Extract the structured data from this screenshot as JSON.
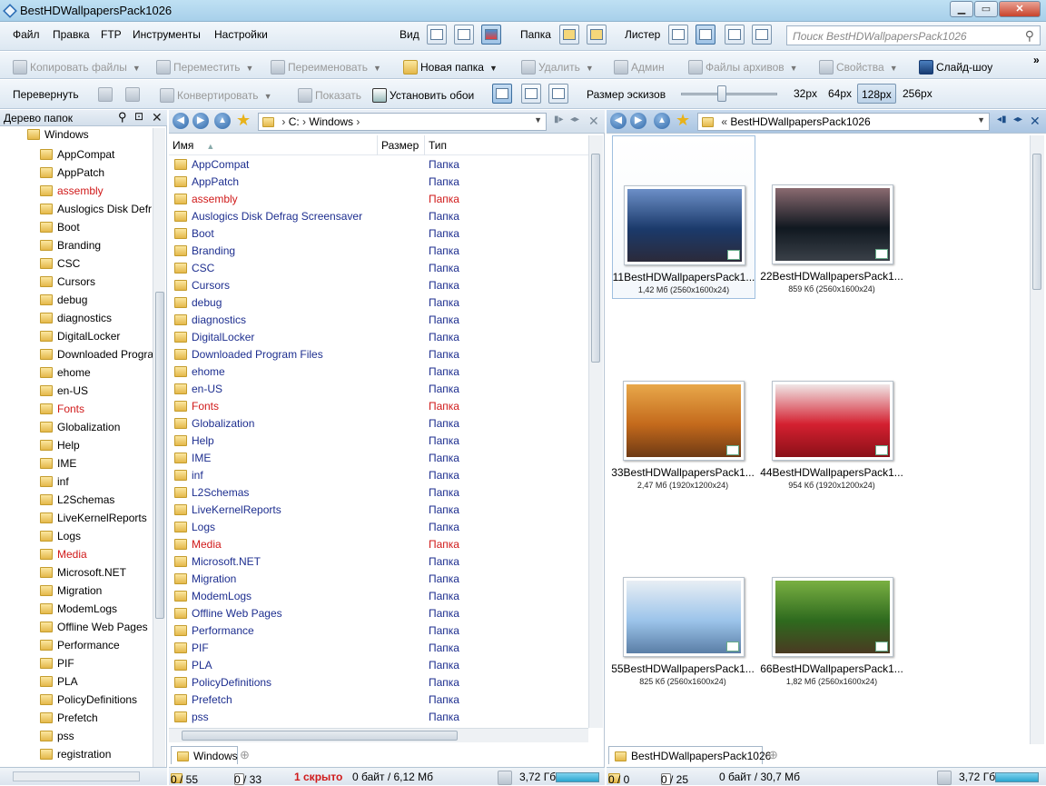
{
  "window": {
    "title": "BestHDWallpapersPack1026"
  },
  "menu": [
    "Файл",
    "Правка",
    "FTP",
    "Инструменты",
    "Настройки"
  ],
  "menu_right": {
    "view_label": "Вид",
    "folder_label": "Папка",
    "lister_label": "Листер"
  },
  "search": {
    "placeholder": "Поиск BestHDWallpapersPack1026"
  },
  "toolbar1": {
    "copy": "Копировать файлы",
    "move": "Переместить",
    "rename": "Переименовать",
    "new_folder": "Новая папка",
    "delete": "Удалить",
    "admin": "Админ",
    "archives": "Файлы архивов",
    "properties": "Свойства",
    "slideshow": "Слайд-шоу",
    "more": "»"
  },
  "toolbar2": {
    "flip": "Перевернуть",
    "convert": "Конвертировать",
    "show": "Показать",
    "set_wallpaper": "Установить обои",
    "thumb_size_label": "Размер эскизов",
    "sizes": [
      "32px",
      "64px",
      "128px",
      "256px"
    ],
    "selected_size": "128px"
  },
  "tree": {
    "header": "Дерево папок",
    "root": "Windows",
    "items": [
      {
        "name": "AppCompat",
        "red": false
      },
      {
        "name": "AppPatch",
        "red": false
      },
      {
        "name": "assembly",
        "red": true
      },
      {
        "name": "Auslogics Disk Defr",
        "red": false
      },
      {
        "name": "Boot",
        "red": false
      },
      {
        "name": "Branding",
        "red": false
      },
      {
        "name": "CSC",
        "red": false
      },
      {
        "name": "Cursors",
        "red": false
      },
      {
        "name": "debug",
        "red": false
      },
      {
        "name": "diagnostics",
        "red": false
      },
      {
        "name": "DigitalLocker",
        "red": false
      },
      {
        "name": "Downloaded Progra",
        "red": false
      },
      {
        "name": "ehome",
        "red": false
      },
      {
        "name": "en-US",
        "red": false
      },
      {
        "name": "Fonts",
        "red": true
      },
      {
        "name": "Globalization",
        "red": false
      },
      {
        "name": "Help",
        "red": false
      },
      {
        "name": "IME",
        "red": false
      },
      {
        "name": "inf",
        "red": false
      },
      {
        "name": "L2Schemas",
        "red": false
      },
      {
        "name": "LiveKernelReports",
        "red": false
      },
      {
        "name": "Logs",
        "red": false
      },
      {
        "name": "Media",
        "red": true
      },
      {
        "name": "Microsoft.NET",
        "red": false
      },
      {
        "name": "Migration",
        "red": false
      },
      {
        "name": "ModemLogs",
        "red": false
      },
      {
        "name": "Offline Web Pages",
        "red": false
      },
      {
        "name": "Performance",
        "red": false
      },
      {
        "name": "PIF",
        "red": false
      },
      {
        "name": "PLA",
        "red": false
      },
      {
        "name": "PolicyDefinitions",
        "red": false
      },
      {
        "name": "Prefetch",
        "red": false
      },
      {
        "name": "pss",
        "red": false
      },
      {
        "name": "registration",
        "red": false
      }
    ]
  },
  "left_pane": {
    "path": [
      "C:",
      "Windows"
    ],
    "columns": {
      "name": "Имя",
      "size": "Размер",
      "type": "Тип"
    },
    "rows": [
      {
        "name": "AppCompat",
        "type": "Папка",
        "red": false
      },
      {
        "name": "AppPatch",
        "type": "Папка",
        "red": false
      },
      {
        "name": "assembly",
        "type": "Папка",
        "red": true
      },
      {
        "name": "Auslogics Disk Defrag Screensaver",
        "type": "Папка",
        "red": false
      },
      {
        "name": "Boot",
        "type": "Папка",
        "red": false
      },
      {
        "name": "Branding",
        "type": "Папка",
        "red": false
      },
      {
        "name": "CSC",
        "type": "Папка",
        "red": false
      },
      {
        "name": "Cursors",
        "type": "Папка",
        "red": false
      },
      {
        "name": "debug",
        "type": "Папка",
        "red": false
      },
      {
        "name": "diagnostics",
        "type": "Папка",
        "red": false
      },
      {
        "name": "DigitalLocker",
        "type": "Папка",
        "red": false
      },
      {
        "name": "Downloaded Program Files",
        "type": "Папка",
        "red": false
      },
      {
        "name": "ehome",
        "type": "Папка",
        "red": false
      },
      {
        "name": "en-US",
        "type": "Папка",
        "red": false
      },
      {
        "name": "Fonts",
        "type": "Папка",
        "red": true
      },
      {
        "name": "Globalization",
        "type": "Папка",
        "red": false
      },
      {
        "name": "Help",
        "type": "Папка",
        "red": false
      },
      {
        "name": "IME",
        "type": "Папка",
        "red": false
      },
      {
        "name": "inf",
        "type": "Папка",
        "red": false
      },
      {
        "name": "L2Schemas",
        "type": "Папка",
        "red": false
      },
      {
        "name": "LiveKernelReports",
        "type": "Папка",
        "red": false
      },
      {
        "name": "Logs",
        "type": "Папка",
        "red": false
      },
      {
        "name": "Media",
        "type": "Папка",
        "red": true
      },
      {
        "name": "Microsoft.NET",
        "type": "Папка",
        "red": false
      },
      {
        "name": "Migration",
        "type": "Папка",
        "red": false
      },
      {
        "name": "ModemLogs",
        "type": "Папка",
        "red": false
      },
      {
        "name": "Offline Web Pages",
        "type": "Папка",
        "red": false
      },
      {
        "name": "Performance",
        "type": "Папка",
        "red": false
      },
      {
        "name": "PIF",
        "type": "Папка",
        "red": false
      },
      {
        "name": "PLA",
        "type": "Папка",
        "red": false
      },
      {
        "name": "PolicyDefinitions",
        "type": "Папка",
        "red": false
      },
      {
        "name": "Prefetch",
        "type": "Папка",
        "red": false
      },
      {
        "name": "pss",
        "type": "Папка",
        "red": false
      }
    ],
    "tab": "Windows",
    "status": {
      "selected": "0 / 55",
      "files": "0 / 33",
      "hidden": "1 скрыто",
      "bytes": "0 байт / 6,12 Мб",
      "free": "3,72 Гб"
    }
  },
  "right_pane": {
    "path": "BestHDWallpapersPack1026",
    "thumbs": [
      {
        "name": "11BestHDWallpapersPack1...",
        "info": "1,42 Мб (2560x1600x24)",
        "colors": [
          "#1b3a6b",
          "#6c8fc7",
          "#2b2a3a"
        ]
      },
      {
        "name": "22BestHDWallpapersPack1...",
        "info": "859 Кб (2560x1600x24)",
        "colors": [
          "#101820",
          "#8a6a70",
          "#3a4048"
        ]
      },
      {
        "name": "33BestHDWallpapersPack1...",
        "info": "2,47 Мб (1920x1200x24)",
        "colors": [
          "#c46a1c",
          "#e8a84a",
          "#6e3a14"
        ]
      },
      {
        "name": "44BestHDWallpapersPack1...",
        "info": "954 Кб (1920x1200x24)",
        "colors": [
          "#d42030",
          "#f0e6e6",
          "#8a1018"
        ]
      },
      {
        "name": "55BestHDWallpapersPack1...",
        "info": "825 Кб (2560x1600x24)",
        "colors": [
          "#9cc4ea",
          "#e8eef4",
          "#5a7ea6"
        ]
      },
      {
        "name": "66BestHDWallpapersPack1...",
        "info": "1,82 Мб (2560x1600x24)",
        "colors": [
          "#2e6a1e",
          "#7ab042",
          "#4a3a22"
        ]
      }
    ],
    "tab": "BestHDWallpapersPack1026",
    "status": {
      "selected": "0 / 0",
      "files": "0 / 25",
      "bytes": "0 байт / 30,7 Мб",
      "free": "3,72 Гб"
    }
  },
  "colors": {
    "accent": "#1d2e8f",
    "red": "#d01a1a",
    "title_bar": "#bfe0f3"
  }
}
